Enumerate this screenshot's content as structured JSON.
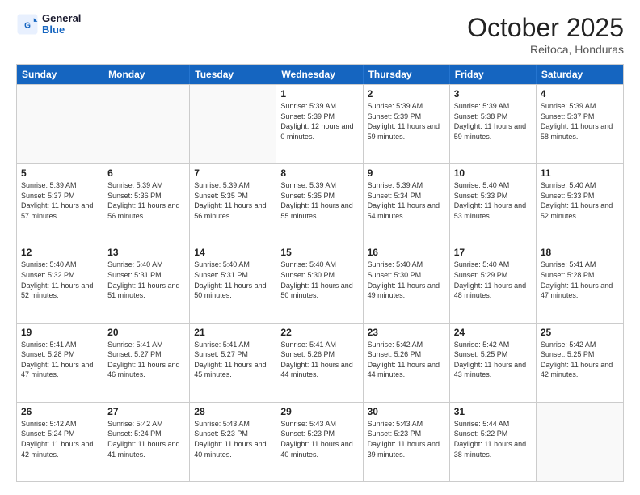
{
  "logo": {
    "line1": "General",
    "line2": "Blue"
  },
  "title": "October 2025",
  "subtitle": "Reitoca, Honduras",
  "days_of_week": [
    "Sunday",
    "Monday",
    "Tuesday",
    "Wednesday",
    "Thursday",
    "Friday",
    "Saturday"
  ],
  "weeks": [
    [
      {
        "day": "",
        "empty": true
      },
      {
        "day": "",
        "empty": true
      },
      {
        "day": "",
        "empty": true
      },
      {
        "day": "1",
        "sunrise": "5:39 AM",
        "sunset": "5:39 PM",
        "daylight": "12 hours and 0 minutes."
      },
      {
        "day": "2",
        "sunrise": "5:39 AM",
        "sunset": "5:39 PM",
        "daylight": "11 hours and 59 minutes."
      },
      {
        "day": "3",
        "sunrise": "5:39 AM",
        "sunset": "5:38 PM",
        "daylight": "11 hours and 59 minutes."
      },
      {
        "day": "4",
        "sunrise": "5:39 AM",
        "sunset": "5:37 PM",
        "daylight": "11 hours and 58 minutes."
      }
    ],
    [
      {
        "day": "5",
        "sunrise": "5:39 AM",
        "sunset": "5:37 PM",
        "daylight": "11 hours and 57 minutes."
      },
      {
        "day": "6",
        "sunrise": "5:39 AM",
        "sunset": "5:36 PM",
        "daylight": "11 hours and 56 minutes."
      },
      {
        "day": "7",
        "sunrise": "5:39 AM",
        "sunset": "5:35 PM",
        "daylight": "11 hours and 56 minutes."
      },
      {
        "day": "8",
        "sunrise": "5:39 AM",
        "sunset": "5:35 PM",
        "daylight": "11 hours and 55 minutes."
      },
      {
        "day": "9",
        "sunrise": "5:39 AM",
        "sunset": "5:34 PM",
        "daylight": "11 hours and 54 minutes."
      },
      {
        "day": "10",
        "sunrise": "5:40 AM",
        "sunset": "5:33 PM",
        "daylight": "11 hours and 53 minutes."
      },
      {
        "day": "11",
        "sunrise": "5:40 AM",
        "sunset": "5:33 PM",
        "daylight": "11 hours and 52 minutes."
      }
    ],
    [
      {
        "day": "12",
        "sunrise": "5:40 AM",
        "sunset": "5:32 PM",
        "daylight": "11 hours and 52 minutes."
      },
      {
        "day": "13",
        "sunrise": "5:40 AM",
        "sunset": "5:31 PM",
        "daylight": "11 hours and 51 minutes."
      },
      {
        "day": "14",
        "sunrise": "5:40 AM",
        "sunset": "5:31 PM",
        "daylight": "11 hours and 50 minutes."
      },
      {
        "day": "15",
        "sunrise": "5:40 AM",
        "sunset": "5:30 PM",
        "daylight": "11 hours and 50 minutes."
      },
      {
        "day": "16",
        "sunrise": "5:40 AM",
        "sunset": "5:30 PM",
        "daylight": "11 hours and 49 minutes."
      },
      {
        "day": "17",
        "sunrise": "5:40 AM",
        "sunset": "5:29 PM",
        "daylight": "11 hours and 48 minutes."
      },
      {
        "day": "18",
        "sunrise": "5:41 AM",
        "sunset": "5:28 PM",
        "daylight": "11 hours and 47 minutes."
      }
    ],
    [
      {
        "day": "19",
        "sunrise": "5:41 AM",
        "sunset": "5:28 PM",
        "daylight": "11 hours and 47 minutes."
      },
      {
        "day": "20",
        "sunrise": "5:41 AM",
        "sunset": "5:27 PM",
        "daylight": "11 hours and 46 minutes."
      },
      {
        "day": "21",
        "sunrise": "5:41 AM",
        "sunset": "5:27 PM",
        "daylight": "11 hours and 45 minutes."
      },
      {
        "day": "22",
        "sunrise": "5:41 AM",
        "sunset": "5:26 PM",
        "daylight": "11 hours and 44 minutes."
      },
      {
        "day": "23",
        "sunrise": "5:42 AM",
        "sunset": "5:26 PM",
        "daylight": "11 hours and 44 minutes."
      },
      {
        "day": "24",
        "sunrise": "5:42 AM",
        "sunset": "5:25 PM",
        "daylight": "11 hours and 43 minutes."
      },
      {
        "day": "25",
        "sunrise": "5:42 AM",
        "sunset": "5:25 PM",
        "daylight": "11 hours and 42 minutes."
      }
    ],
    [
      {
        "day": "26",
        "sunrise": "5:42 AM",
        "sunset": "5:24 PM",
        "daylight": "11 hours and 42 minutes."
      },
      {
        "day": "27",
        "sunrise": "5:42 AM",
        "sunset": "5:24 PM",
        "daylight": "11 hours and 41 minutes."
      },
      {
        "day": "28",
        "sunrise": "5:43 AM",
        "sunset": "5:23 PM",
        "daylight": "11 hours and 40 minutes."
      },
      {
        "day": "29",
        "sunrise": "5:43 AM",
        "sunset": "5:23 PM",
        "daylight": "11 hours and 40 minutes."
      },
      {
        "day": "30",
        "sunrise": "5:43 AM",
        "sunset": "5:23 PM",
        "daylight": "11 hours and 39 minutes."
      },
      {
        "day": "31",
        "sunrise": "5:44 AM",
        "sunset": "5:22 PM",
        "daylight": "11 hours and 38 minutes."
      },
      {
        "day": "",
        "empty": true
      }
    ]
  ]
}
